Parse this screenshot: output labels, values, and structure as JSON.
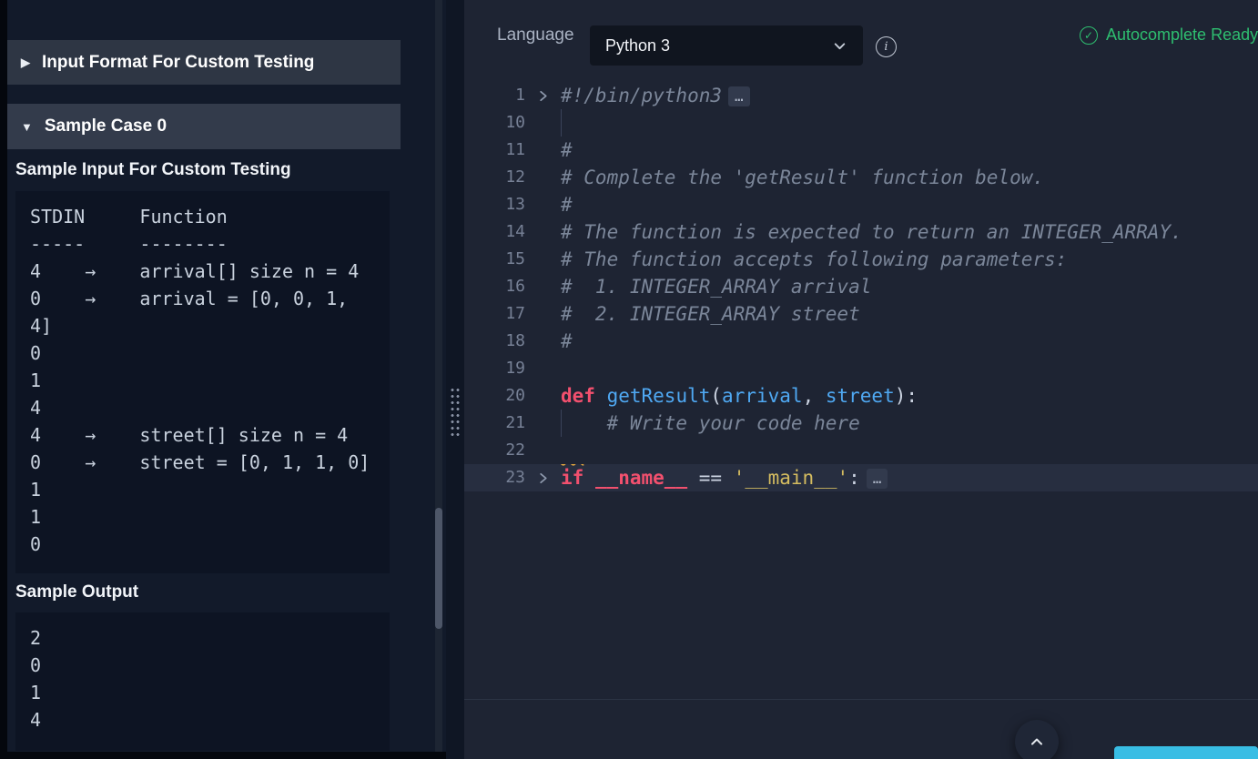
{
  "left_panel": {
    "sections": [
      {
        "arrow": "▶",
        "label": "Input Format For Custom Testing"
      },
      {
        "arrow": "▼",
        "label": "Sample Case 0"
      }
    ],
    "sample_input_heading": "Sample Input For Custom Testing",
    "sample_input_lines": [
      "STDIN     Function",
      "-----     --------",
      "4    →    arrival[] size n = 4",
      "0    →    arrival = [0, 0, 1,",
      "4]",
      "0",
      "1",
      "4",
      "4    →    street[] size n = 4",
      "0    →    street = [0, 1, 1, 0]",
      "1",
      "1",
      "0"
    ],
    "sample_output_heading": "Sample Output",
    "sample_output_lines": [
      "2",
      "0",
      "1",
      "4"
    ]
  },
  "toolbar": {
    "language_label": "Language",
    "language_value": "Python 3",
    "info_icon": "info-icon",
    "autocomplete_status": "Autocomplete Ready",
    "autocomplete_check": "✓"
  },
  "editor": {
    "lines": [
      {
        "num": "1",
        "fold": true,
        "ellipsis": true,
        "segments": [
          {
            "t": "#!/bin/python3",
            "s": "comment"
          }
        ]
      },
      {
        "num": "10",
        "guide": true,
        "segments": []
      },
      {
        "num": "11",
        "segments": [
          {
            "t": "#",
            "s": "comment"
          }
        ]
      },
      {
        "num": "12",
        "segments": [
          {
            "t": "# Complete the 'getResult' function below.",
            "s": "comment"
          }
        ]
      },
      {
        "num": "13",
        "segments": [
          {
            "t": "#",
            "s": "comment"
          }
        ]
      },
      {
        "num": "14",
        "segments": [
          {
            "t": "# The function is expected to return an INTEGER_ARRAY.",
            "s": "comment"
          }
        ]
      },
      {
        "num": "15",
        "segments": [
          {
            "t": "# The function accepts following parameters:",
            "s": "comment"
          }
        ]
      },
      {
        "num": "16",
        "segments": [
          {
            "t": "#  1. INTEGER_ARRAY arrival",
            "s": "comment"
          }
        ]
      },
      {
        "num": "17",
        "segments": [
          {
            "t": "#  2. INTEGER_ARRAY street",
            "s": "comment"
          }
        ]
      },
      {
        "num": "18",
        "segments": [
          {
            "t": "#",
            "s": "comment"
          }
        ]
      },
      {
        "num": "19",
        "segments": []
      },
      {
        "num": "20",
        "segments": [
          {
            "t": "def",
            "s": "keyword"
          },
          {
            "t": " ",
            "s": "plain"
          },
          {
            "t": "getResult",
            "s": "function"
          },
          {
            "t": "(",
            "s": "plain"
          },
          {
            "t": "arrival",
            "s": "param"
          },
          {
            "t": ", ",
            "s": "plain"
          },
          {
            "t": "street",
            "s": "param"
          },
          {
            "t": "):",
            "s": "plain"
          }
        ]
      },
      {
        "num": "21",
        "guide": true,
        "segments": [
          {
            "t": "    # Write your code here",
            "s": "comment"
          }
        ]
      },
      {
        "num": "22",
        "segments": []
      },
      {
        "num": "23",
        "fold": true,
        "ellipsis": true,
        "highlight": true,
        "segments": [
          {
            "t": "if",
            "s": "keyword squiggle"
          },
          {
            "t": " ",
            "s": "plain"
          },
          {
            "t": "__name__",
            "s": "keyword"
          },
          {
            "t": " == ",
            "s": "plain"
          },
          {
            "t": "'__main__'",
            "s": "string"
          },
          {
            "t": ":",
            "s": "plain"
          }
        ]
      }
    ]
  },
  "colors": {
    "accent_green": "#2ebf70",
    "run_bar_cyan": "#38bde4",
    "keyword_red": "#f2506e",
    "function_blue": "#4fa8f2",
    "string_yellow": "#d4bc60",
    "comment_gray": "#7b8699"
  },
  "icons": {
    "collapsed_arrow": "triangle-right-icon",
    "expanded_arrow": "triangle-down-icon",
    "dropdown": "chevron-down-icon",
    "fold": "chevron-right-icon",
    "scroll_top": "chevron-up-icon"
  }
}
